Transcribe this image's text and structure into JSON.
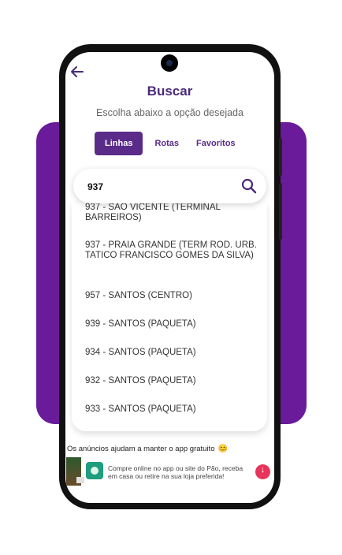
{
  "header": {
    "title": "Buscar",
    "subtitle": "Escolha abaixo a opção desejada"
  },
  "tabs": [
    {
      "label": "Linhas",
      "active": true
    },
    {
      "label": "Rotas",
      "active": false
    },
    {
      "label": "Favoritos",
      "active": false
    }
  ],
  "search": {
    "value": "937",
    "icon": "search-icon"
  },
  "results": [
    {
      "text": "937 - SAO VICENTE (TERMINAL BARREIROS)"
    },
    {
      "text": "937 - PRAIA GRANDE (TERM ROD. URB. TATICO FRANCISCO GOMES DA SILVA)"
    },
    {
      "text": "957 - SANTOS (CENTRO)"
    },
    {
      "text": "939 - SANTOS (PAQUETA)"
    },
    {
      "text": "934 - SANTOS (PAQUETA)"
    },
    {
      "text": "932 - SANTOS (PAQUETA)"
    },
    {
      "text": "933 - SANTOS (PAQUETA)"
    }
  ],
  "ad": {
    "notice": "Os anúncios ajudam a manter o app gratuito",
    "notice_emoji": "😊",
    "copy": "Compre online no app ou site do Pão, receba em casa ou retire na sua loja preferida!"
  },
  "colors": {
    "brand_purple": "#5b2b8a",
    "background_purple": "#6a1b9a",
    "download_button": "#e8345a"
  }
}
